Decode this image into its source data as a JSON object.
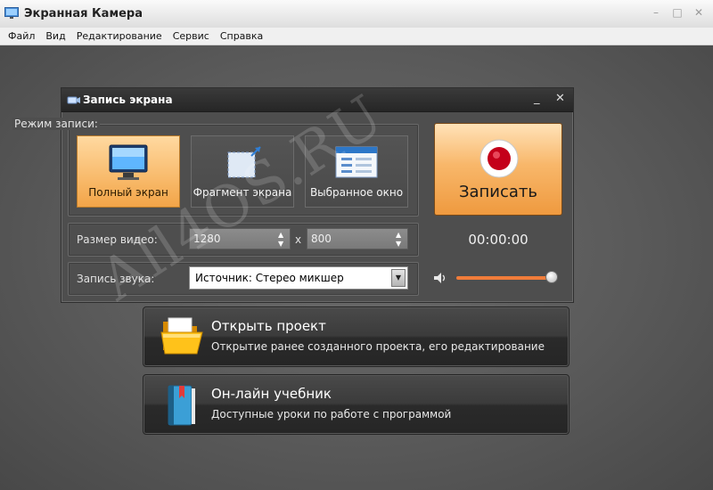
{
  "window": {
    "title": "Экранная Камера",
    "controls": [
      "–",
      "□",
      "✕"
    ]
  },
  "menu": [
    "Файл",
    "Вид",
    "Редактирование",
    "Сервис",
    "Справка"
  ],
  "watermark": "All4OS.RU",
  "panel": {
    "title": "Запись экрана",
    "minimize": "_",
    "close": "✕",
    "mode_label": "Режим записи:",
    "modes": [
      {
        "label": "Полный экран",
        "active": true
      },
      {
        "label": "Фрагмент экрана",
        "active": false
      },
      {
        "label": "Выбранное окно",
        "active": false
      }
    ],
    "record_label": "Записать",
    "timer": "00:00:00",
    "video_size": {
      "label": "Размер видео:",
      "width": "1280",
      "separator": "x",
      "height": "800"
    },
    "audio": {
      "label": "Запись звука:",
      "source": "Источник: Стерео микшер",
      "volume": 1.0
    }
  },
  "actions": [
    {
      "title": "Открыть проект",
      "subtitle": "Открытие ранее созданного проекта, его редактирование",
      "icon": "folder-icon"
    },
    {
      "title": "Он-лайн учебник",
      "subtitle": "Доступные уроки по работе с программой",
      "icon": "book-icon"
    }
  ],
  "colors": {
    "accent": "#f3a548",
    "record": "#c4001a",
    "slider": "#f07c3a"
  }
}
